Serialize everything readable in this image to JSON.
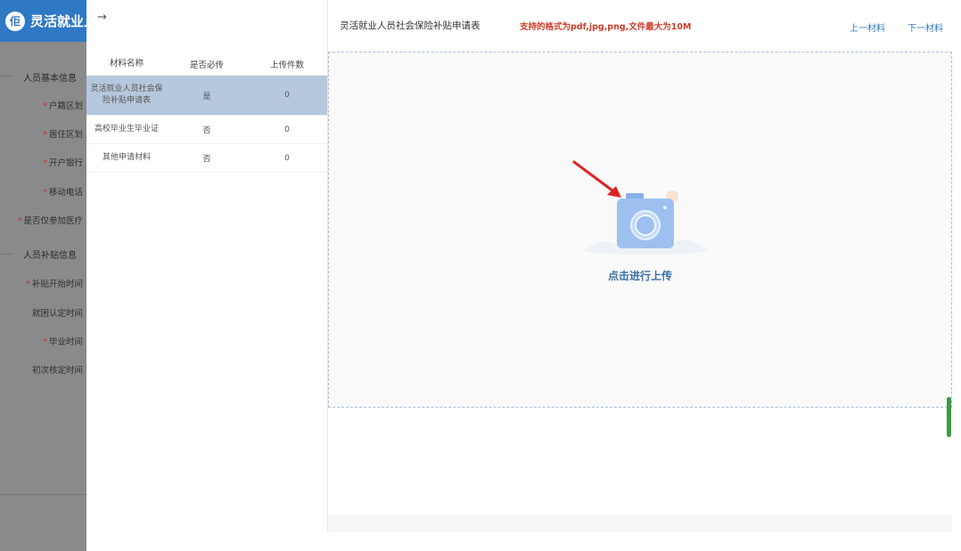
{
  "background": {
    "app_title": "灵活就业人员",
    "logo_glyph": "佢",
    "sections": [
      {
        "label": "人员基本信息"
      },
      {
        "label": "人员补贴信息"
      }
    ],
    "fields": [
      {
        "label": "户籍区划",
        "required": true
      },
      {
        "label": "居住区划",
        "required": true
      },
      {
        "label": "开户银行",
        "required": true
      },
      {
        "label": "移动电话",
        "required": true
      },
      {
        "label": "是否仅参加医疗",
        "required": true
      },
      {
        "label": "补贴开始时间",
        "required": true
      },
      {
        "label": "就困认定时间",
        "required": false
      },
      {
        "label": "毕业时间",
        "required": true
      },
      {
        "label": "初次核定时间",
        "required": false
      }
    ]
  },
  "drawer": {
    "back_icon": "→",
    "table": {
      "headers": [
        "材料名称",
        "是否必传",
        "上传件数"
      ],
      "rows": [
        {
          "name": "灵活就业人员社会保险补贴申请表",
          "required": "是",
          "count": "0",
          "active": true
        },
        {
          "name": "高校毕业生毕业证",
          "required": "否",
          "count": "0",
          "active": false
        },
        {
          "name": "其他申请材料",
          "required": "否",
          "count": "0",
          "active": false
        }
      ]
    }
  },
  "viewer": {
    "doc_title": "灵活就业人员社会保险补贴申请表",
    "format_note": "支持的格式为pdf,jpg,png,文件最大为10M",
    "prev_label": "上一材料",
    "next_label": "下一材料",
    "upload_label": "点击进行上传",
    "upload_icon": "camera-icon"
  },
  "colors": {
    "accent": "#2f78c4",
    "active_row": "#b6c8de",
    "warning": "#d23d2a",
    "camera": "#9ec0f0"
  }
}
